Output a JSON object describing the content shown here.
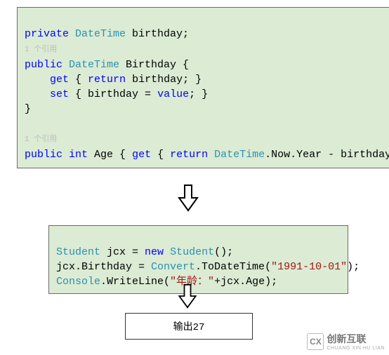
{
  "code1": {
    "l1": {
      "kw1": "private",
      "type": "DateTime",
      "name": " birthday;"
    },
    "ref1": "1 个引用",
    "l2": {
      "kw1": "public",
      "type": "DateTime",
      "name": " Birthday {"
    },
    "l3": {
      "kw1": "get",
      "rest": " { ",
      "kw2": "return",
      "rest2": " birthday; }"
    },
    "l4": {
      "kw1": "set",
      "rest": " { birthday = ",
      "kw2": "value",
      "rest2": "; }"
    },
    "l5": "}",
    "blank": "",
    "ref2": "1 个引用",
    "l6": {
      "kw1": "public",
      "kw2": "int",
      "name": " Age { ",
      "kw3": "get",
      "rest1": " { ",
      "kw4": "return",
      "type": "DateTime",
      "rest2": ".Now.Year - birthday.Year; } }"
    }
  },
  "code2": {
    "l1": {
      "type": "Student",
      "rest1": " jcx = ",
      "kw": "new",
      "type2": "Student",
      "rest2": "();"
    },
    "l2": {
      "rest1": "jcx.Birthday = ",
      "type": "Convert",
      "rest2": ".ToDateTime(",
      "str": "\"1991-10-01\"",
      "rest3": ");"
    },
    "l3": {
      "type": "Console",
      "rest1": ".WriteLine(",
      "str": "\"年龄：\"",
      "rest2": "+jcx.Age);"
    }
  },
  "output": "输出27",
  "logo_text": "创新互联",
  "logo_sub": "CHUANG XIN HU LIAN"
}
